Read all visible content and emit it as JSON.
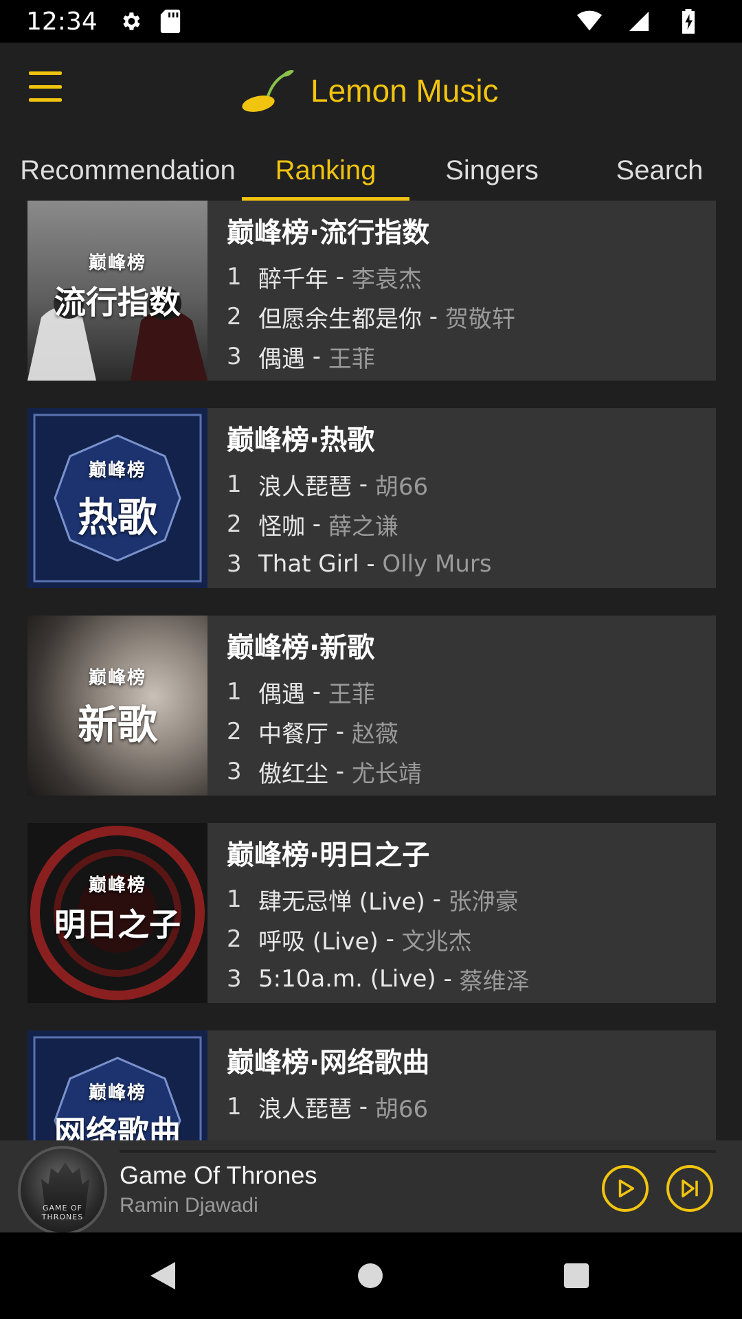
{
  "status_bar": {
    "time": "12:34",
    "icons": [
      "settings-icon",
      "sd-card-icon",
      "wifi-icon",
      "cell-signal-icon",
      "battery-charging-icon"
    ]
  },
  "app": {
    "title": "Lemon Music",
    "accent_color": "#f1c40f",
    "menu_icon": "hamburger-menu-icon",
    "logo_icon": "lemon-sprout-logo-icon"
  },
  "tabs": [
    {
      "label": "Recommendation",
      "active": false
    },
    {
      "label": "Ranking",
      "active": true
    },
    {
      "label": "Singers",
      "active": false
    },
    {
      "label": "Search",
      "active": false
    }
  ],
  "rankings": [
    {
      "title": "巅峰榜·流行指数",
      "cover_text": "流行指数",
      "cover_crown": "巅峰榜",
      "songs": [
        {
          "rank": "1",
          "song": "醉千年",
          "artist": "李袁杰"
        },
        {
          "rank": "2",
          "song": "但愿余生都是你",
          "artist": "贺敬轩"
        },
        {
          "rank": "3",
          "song": "偶遇",
          "artist": "王菲"
        }
      ]
    },
    {
      "title": "巅峰榜·热歌",
      "cover_text": "热歌",
      "cover_crown": "巅峰榜",
      "songs": [
        {
          "rank": "1",
          "song": "浪人琵琶",
          "artist": "胡66"
        },
        {
          "rank": "2",
          "song": "怪咖",
          "artist": "薛之谦"
        },
        {
          "rank": "3",
          "song": "That Girl",
          "artist": "Olly Murs"
        }
      ]
    },
    {
      "title": "巅峰榜·新歌",
      "cover_text": "新歌",
      "cover_crown": "巅峰榜",
      "songs": [
        {
          "rank": "1",
          "song": "偶遇",
          "artist": "王菲"
        },
        {
          "rank": "2",
          "song": "中餐厅",
          "artist": "赵薇"
        },
        {
          "rank": "3",
          "song": "傲红尘",
          "artist": "尤长靖"
        }
      ]
    },
    {
      "title": "巅峰榜·明日之子",
      "cover_text": "明日之子",
      "cover_crown": "巅峰榜",
      "songs": [
        {
          "rank": "1",
          "song": "肆无忌惮 (Live)",
          "artist": "张洢豪"
        },
        {
          "rank": "2",
          "song": "呼吸 (Live)",
          "artist": "文兆杰"
        },
        {
          "rank": "3",
          "song": "5:10a.m. (Live)",
          "artist": "蔡维泽"
        }
      ]
    },
    {
      "title": "巅峰榜·网络歌曲",
      "cover_text": "网络歌曲",
      "cover_crown": "巅峰榜",
      "songs": [
        {
          "rank": "1",
          "song": "浪人琵琶",
          "artist": "胡66"
        }
      ]
    }
  ],
  "player": {
    "title": "Game Of Thrones",
    "artist": "Ramin Djawadi",
    "cover_label": "GAME OF THRONES",
    "play_icon": "play-circle-icon",
    "next_icon": "skip-next-circle-icon"
  },
  "nav_bar": {
    "icons": [
      "back-triangle-icon",
      "home-circle-icon",
      "recents-square-icon"
    ]
  }
}
